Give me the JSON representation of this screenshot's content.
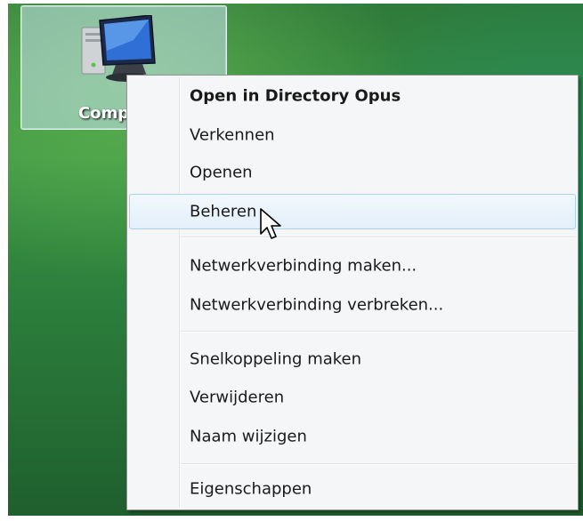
{
  "desktop": {
    "icon": {
      "label": "Comp",
      "icon_name": "computer-icon"
    }
  },
  "context_menu": {
    "items": [
      {
        "label": "Open in Directory Opus",
        "bold": true
      },
      {
        "label": "Verkennen"
      },
      {
        "label": "Openen"
      },
      {
        "label": "Beheren",
        "hovered": true
      },
      {
        "label": "Netwerkverbinding maken..."
      },
      {
        "label": "Netwerkverbinding verbreken..."
      },
      {
        "label": "Snelkoppeling maken"
      },
      {
        "label": "Verwijderen"
      },
      {
        "label": "Naam wijzigen"
      },
      {
        "label": "Eigenschappen"
      }
    ]
  },
  "cursor": {
    "icon_name": "arrow-cursor-icon"
  },
  "colors": {
    "menu_background": "#f5f6f7",
    "hover_border": "#a8d4f0",
    "selection_background": "#c8e4f0"
  }
}
